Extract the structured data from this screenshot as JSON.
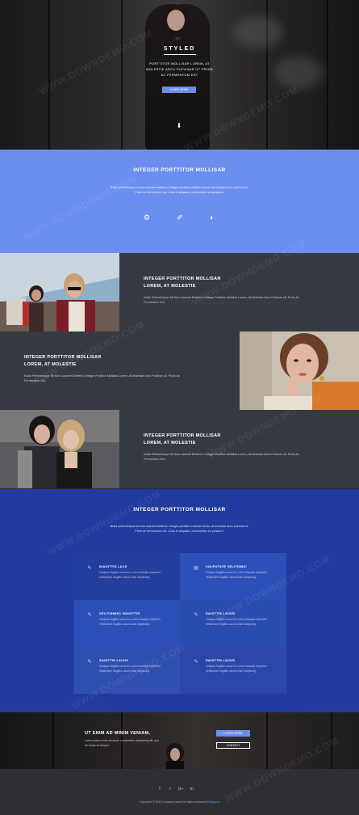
{
  "hero": {
    "brand": "STYLED",
    "text": "PORTTITOR MOLLISAR LOREM, AT MOLESTIE ARCU PULVINAR UT PROIN AC FERMENTUM EST",
    "button_label": "LEARN MORE",
    "scroll_icon": "arrow-down-icon"
  },
  "intro": {
    "title": "INTEGER PORTTITOR MOLLISAR",
    "text": "Nulla pellentesque mi non laoreet eleifend. Integer porttitor mollisar lorem, at molestie arcu pulvinar ut. Proin ac fermentum est. Cras et aliquam, consectetur ex posuere.",
    "icons": [
      "gear-icon",
      "link-icon",
      "chart-icon"
    ]
  },
  "rows": [
    {
      "title_line1": "INTEGER PORTTITOR MOLLISAR",
      "title_line2": "LOREM, AT MOLESTIE",
      "text": "Nulla Pellentesque Mi Non Laoreet Eleifend. Integer Porttitor Mollisar Lorem, At Molestie Arcu Pulvinar Ut. Proin Ac Fermentum Est."
    },
    {
      "title_line1": "INTEGER PORTTITOR MOLLISAR",
      "title_line2": "LOREM, AT MOLESTIE",
      "text": "Nulla Pellentesque Mi Non Laoreet Eleifend. Integer Porttitor Mollisar Lorem, At Molestie Arcu Pulvinar Ut. Proin Ac Fermentum Est."
    },
    {
      "title_line1": "INTEGER PORTTITOR MOLLISAR",
      "title_line2": "LOREM, AT MOLESTIE",
      "text": "Nulla Pellentesque Mi Non Laoreet Eleifend. Integer Porttitor Mollisar Lorem, At Molestie Arcu Pulvinar Ut. Proin Ac Fermentum Est."
    }
  ],
  "services": {
    "title": "INTEGER PORTTITOR MOLLISAR",
    "text": "Nulla pellentesque mi non laoreet eleifend. Integer porttitor mollisar lorem, at molestie arcu pulvinar ut. Proin ac fermentum est. Cras et aliquam, consectetur ex posuere.",
    "items": [
      {
        "icon": "pencil-icon",
        "title": "INAGITTIS LACS",
        "text": "Volutpat Sagittis Lacus Eu Lorem Suscipit Imperdiet Vestibulum Sagittis Lacus Dolor Adipiscing."
      },
      {
        "icon": "doc-icon",
        "title": "VULPUTATE VELITISMIC",
        "text": "Volutpat Sagittis Lacus Eu Lorem Suscipit Imperdiet Vestibulum Sagittis Lacus Dolor Adipiscing."
      },
      {
        "icon": "pencil-icon",
        "title": "VELITISMISC INAGITTIS",
        "text": "Volutpat Sagittis Lacus Eu Lorem Suscipit Imperdiet Vestibulum Sagittis Lacus Dolor Adipiscing."
      },
      {
        "icon": "pencil-icon",
        "title": "SAGITTIS LACUS",
        "text": "Volutpat Sagittis Lacus Eu Lorem Suscipit Imperdiet Vestibulum Sagittis Lacus Dolor Adipiscing."
      },
      {
        "icon": "pencil-icon",
        "title": "SAGITTIS LACUS",
        "text": "Volutpat Sagittis Lacus Eu Lorem Suscipit Imperdiet Vestibulum Sagittis Lacus Dolor Adipiscing."
      },
      {
        "icon": "pencil-icon",
        "title": "SAGITTIS LACUS",
        "text": "Volutpat Sagittis Lacus Eu Lorem Suscipit Imperdiet Vestibulum Sagittis Lacus Dolor Adipiscing."
      }
    ]
  },
  "cta": {
    "title": "UT ENIM AD MINIM VENIAM,",
    "text": "Lorem ipsum dolor sit amet, consectetur adipiscing elit, sed do eiusmod tempor.",
    "primary_label": "LEARN MORE",
    "secondary_label": "CONTACT"
  },
  "footer": {
    "social_icons": [
      "facebook-icon",
      "twitter-icon",
      "google-plus-icon",
      "linkedin-icon"
    ],
    "copyright": "Copyright © 2019 Company name All rights reserved",
    "link_text": "W3layouts"
  },
  "watermark": "WWW.DOWNDEMO.COM",
  "colors": {
    "accent": "#6b8fe8",
    "intro_bg": "#6b8ff0",
    "row_bg": "#363a43",
    "services_bg": "#223b9e",
    "footer_bg": "#2e2f33"
  }
}
